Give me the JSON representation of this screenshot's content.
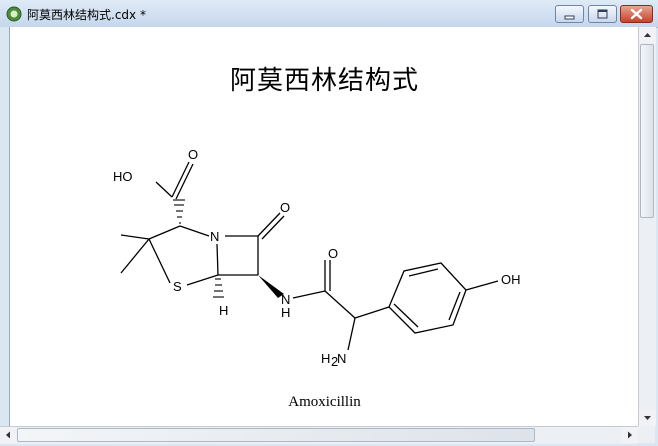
{
  "window": {
    "title": "阿莫西林结构式.cdx *",
    "icons": [
      "app-icon",
      "minimize-icon",
      "maximize-icon",
      "close-icon"
    ]
  },
  "document": {
    "heading": "阿莫西林结构式",
    "caption": "Amoxicillin",
    "atoms": {
      "o_carboxyl": "O",
      "ho": "HO",
      "o_lactam": "O",
      "n_ring": "N",
      "s_ring": "S",
      "h_bridge": "H",
      "n_amide": "N",
      "h_amide": "H",
      "o_amide": "O",
      "oh_phenol": "OH",
      "h2n_h": "H",
      "h2n_2": "2",
      "h2n_n": "N"
    }
  },
  "colors": {
    "titlebar": "#c6d7ec",
    "canvas": "#ffffff",
    "close_button": "#c7432b"
  }
}
